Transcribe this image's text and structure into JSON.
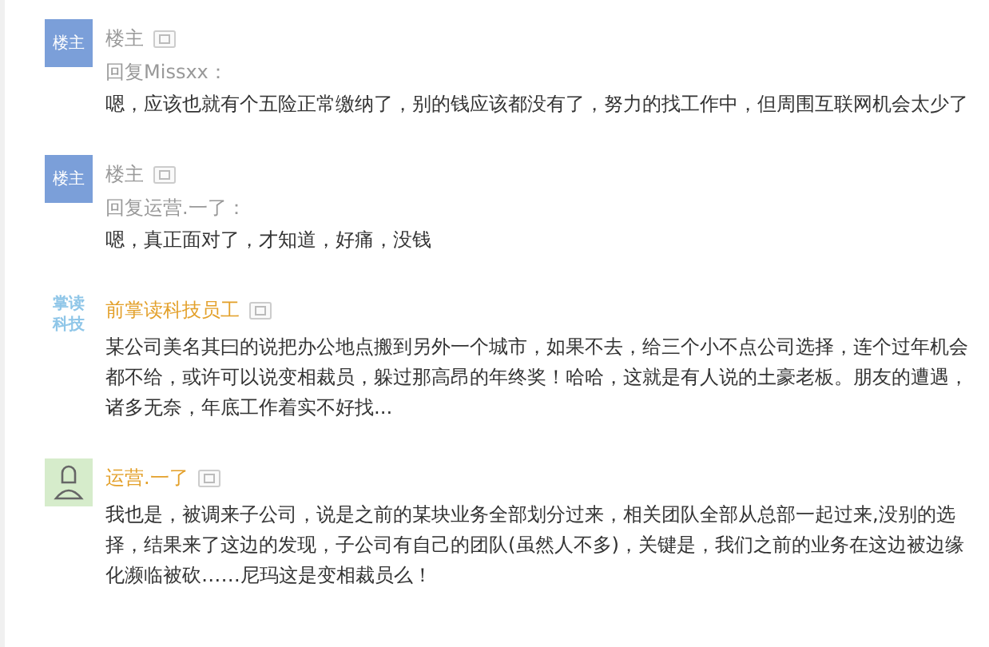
{
  "comments": [
    {
      "avatar": {
        "kind": "label",
        "lines": [
          "楼主"
        ]
      },
      "author": "楼主",
      "highlighted": false,
      "reply_to": "回复Missxx：",
      "text": "嗯，应该也就有个五险正常缴纳了，别的钱应该都没有了，努力的找工作中，但周围互联网机会太少了"
    },
    {
      "avatar": {
        "kind": "label",
        "lines": [
          "楼主"
        ]
      },
      "author": "楼主",
      "highlighted": false,
      "reply_to": "回复运营.一了：",
      "text": "嗯，真正面对了，才知道，好痛，没钱"
    },
    {
      "avatar": {
        "kind": "logo",
        "lines": [
          "掌读",
          "科技"
        ]
      },
      "author": "前掌读科技员工",
      "highlighted": true,
      "text": "某公司美名其曰的说把办公地点搬到另外一个城市，如果不去，给三个小不点公司选择，连个过年机会都不给，或许可以说变相裁员，躲过那高昂的年终奖！哈哈，这就是有人说的土豪老板。朋友的遭遇，诸多无奈，年底工作着实不好找..."
    },
    {
      "avatar": {
        "kind": "figure"
      },
      "author": "运营.一了",
      "highlighted": true,
      "text": "我也是，被调来子公司，说是之前的某块业务全部划分过来，相关团队全部从总部一起过来,没别的选择，结果来了这边的发现，子公司有自己的团队(虽然人不多)，关键是，我们之前的业务在这边被边缘化濒临被砍……尼玛这是变相裁员么！"
    }
  ]
}
